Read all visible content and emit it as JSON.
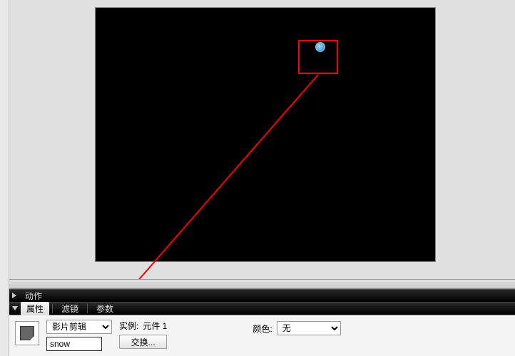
{
  "panels": {
    "actions": {
      "label": "动作"
    },
    "tabs": {
      "properties": "属性",
      "filters": "滤镜",
      "params": "参数"
    }
  },
  "properties": {
    "type_label": "影片剪辑",
    "instance_name": "snow",
    "instance_title": "实例:",
    "instance_value": "元件 1",
    "swap_label": "交换...",
    "color_label": "颜色:",
    "color_value": "无"
  }
}
